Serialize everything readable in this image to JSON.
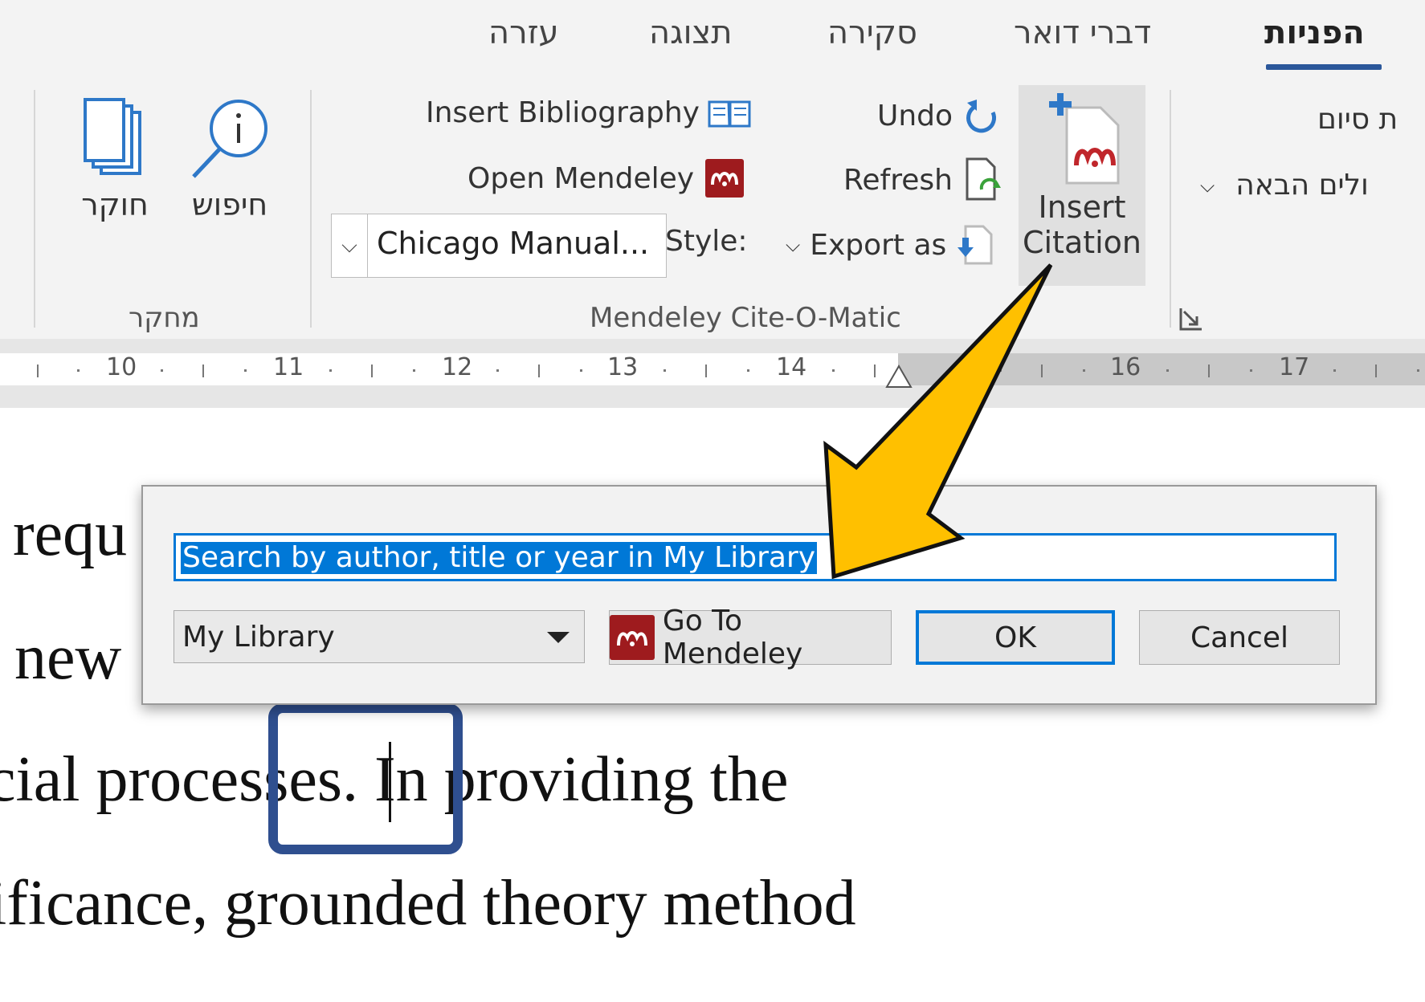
{
  "ribbon": {
    "tabs": [
      "הפניות",
      "דברי דואר",
      "סקירה",
      "תצוגה",
      "עזרה"
    ],
    "research_group": {
      "label": "מחקר",
      "search_label": "חיפוש",
      "researcher_label": "חוקר"
    },
    "mendeley_group": {
      "label": "Mendeley Cite-O-Matic",
      "insert_bibliography": "Insert Bibliography",
      "open_mendeley": "Open Mendeley",
      "style_label": "Style:",
      "style_value": "Chicago Manual...",
      "undo": "Undo",
      "refresh": "Refresh",
      "export_as": "Export as",
      "insert_citation_line1": "Insert",
      "insert_citation_line2": "Citation"
    },
    "right_partial": {
      "line1": "ת סיום",
      "line2": "ולים הבאה"
    }
  },
  "ruler": {
    "numbers": [
      "10",
      "11",
      "12",
      "13",
      "14",
      "16",
      "17"
    ]
  },
  "document": {
    "lines": [
      "requ",
      "new",
      "cial processes. In providing the",
      "ificance, grounded theory method"
    ]
  },
  "dialog": {
    "search_placeholder": "Search by author, title or year in My Library",
    "library_value": "My Library",
    "go_to_mendeley": "Go To Mendeley",
    "ok": "OK",
    "cancel": "Cancel"
  },
  "colors": {
    "accent": "#0078d7",
    "tab_underline": "#2b579a",
    "mendeley_red": "#9e1b1e",
    "arrow_fill": "#ffc000",
    "highlight_border": "#2f4f8f"
  }
}
